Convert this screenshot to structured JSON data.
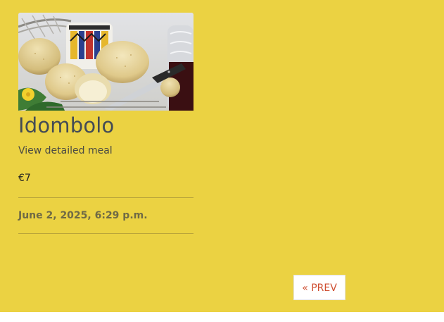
{
  "meal": {
    "image_alt": "Idombolo steamed bread",
    "title": "Idombolo",
    "detail_link": "View detailed meal",
    "price": "€7",
    "date": "June 2, 2025, 6:29 p.m."
  },
  "pagination": {
    "prev_label": "« PREV"
  },
  "colors": {
    "page_background": "#ebd242",
    "title": "#434b55",
    "prev_text": "#cf4f32"
  }
}
